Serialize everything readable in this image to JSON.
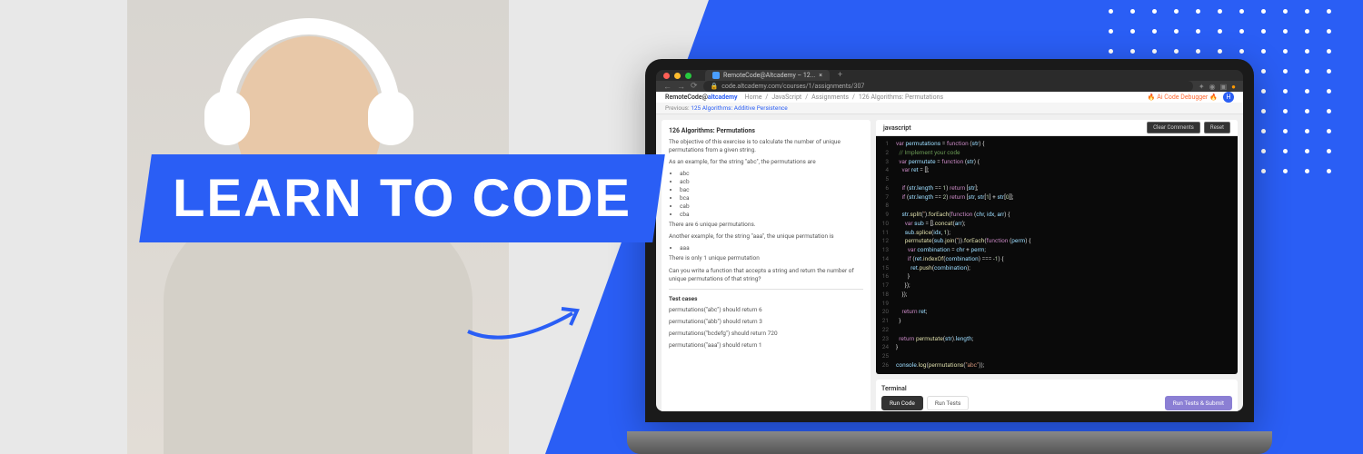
{
  "banner": "LEARN TO CODE",
  "browser": {
    "tab_title": "RemoteCode@Altcademy – 12...",
    "url": "code.altcademy.com/courses/1/assignments/307"
  },
  "header": {
    "logo_prefix": "RemoteCode@",
    "logo_brand": "altcademy",
    "breadcrumb": [
      "Home",
      "JavaScript",
      "Assignments",
      "126 Algorithms: Permutations"
    ],
    "ai_debugger": "Ai Code Debugger",
    "avatar_initial": "H"
  },
  "previous": {
    "label": "Previous:",
    "link": "125 Algorithms: Additive Persistence"
  },
  "problem": {
    "title": "126 Algorithms: Permutations",
    "objective": "The objective of this exercise is to calculate the number of unique permutations from a given string.",
    "example_intro": "As an example, for the string \"abc\", the permutations are",
    "perms": [
      "abc",
      "acb",
      "bac",
      "bca",
      "cab",
      "cba"
    ],
    "count_note": "There are 6 unique permutations.",
    "example2_intro": "Another example, for the string \"aaa\", the unique permutation is",
    "perms2": [
      "aaa"
    ],
    "count_note2": "There is only 1 unique permutation",
    "question": "Can you write a function that accepts a string and return the number of unique permutations of that string?",
    "test_title": "Test cases",
    "tests": [
      "permutations(\"abc\") should return 6",
      "permutations(\"abb\") should return 3",
      "permutations(\"bcdefg\") should return 720",
      "permutations(\"aaa\") should return 1"
    ]
  },
  "editor": {
    "language": "javascript",
    "clear_btn": "Clear Comments",
    "reset_btn": "Reset",
    "code": [
      {
        "n": "1",
        "html": "<span class='kw'>var</span> <span class='var'>permutations</span> <span class='op'>=</span> <span class='kw'>function</span> (<span class='var'>str</span>) {"
      },
      {
        "n": "2",
        "html": "  <span class='cm'>// Implement your code</span>"
      },
      {
        "n": "3",
        "html": "  <span class='kw'>var</span> <span class='var'>permutate</span> <span class='op'>=</span> <span class='kw'>function</span> (<span class='var'>str</span>) {"
      },
      {
        "n": "4",
        "html": "    <span class='kw'>var</span> <span class='var'>ret</span> <span class='op'>=</span> [];"
      },
      {
        "n": "5",
        "html": ""
      },
      {
        "n": "6",
        "html": "    <span class='kw'>if</span> (<span class='var'>str</span>.<span class='var'>length</span> <span class='op'>==</span> <span class='num'>1</span>) <span class='kw'>return</span> [<span class='var'>str</span>];"
      },
      {
        "n": "7",
        "html": "    <span class='kw'>if</span> (<span class='var'>str</span>.<span class='var'>length</span> <span class='op'>==</span> <span class='num'>2</span>) <span class='kw'>return</span> [<span class='var'>str</span>, <span class='var'>str</span>[<span class='num'>1</span>] + <span class='var'>str</span>[<span class='num'>0</span>]];"
      },
      {
        "n": "8",
        "html": ""
      },
      {
        "n": "9",
        "html": "    <span class='var'>str</span>.<span class='fn'>split</span>(<span class='str'>''</span>).<span class='fn'>forEach</span>(<span class='kw'>function</span> (<span class='var'>chr</span>, <span class='var'>idx</span>, <span class='var'>arr</span>) {"
      },
      {
        "n": "10",
        "html": "      <span class='kw'>var</span> <span class='var'>sub</span> <span class='op'>=</span> [].<span class='fn'>concat</span>(<span class='var'>arr</span>);"
      },
      {
        "n": "11",
        "html": "      <span class='var'>sub</span>.<span class='fn'>splice</span>(<span class='var'>idx</span>, <span class='num'>1</span>);"
      },
      {
        "n": "12",
        "html": "      <span class='fn'>permutate</span>(<span class='var'>sub</span>.<span class='fn'>join</span>(<span class='str'>''</span>)).<span class='fn'>forEach</span>(<span class='kw'>function</span> (<span class='var'>perm</span>) {"
      },
      {
        "n": "13",
        "html": "        <span class='kw'>var</span> <span class='var'>combination</span> <span class='op'>=</span> <span class='var'>chr</span> + <span class='var'>perm</span>;"
      },
      {
        "n": "14",
        "html": "        <span class='kw'>if</span> (<span class='var'>ret</span>.<span class='fn'>indexOf</span>(<span class='var'>combination</span>) <span class='op'>===</span> <span class='op'>-</span><span class='num'>1</span>) {"
      },
      {
        "n": "15",
        "html": "          <span class='var'>ret</span>.<span class='fn'>push</span>(<span class='var'>combination</span>);"
      },
      {
        "n": "16",
        "html": "        }"
      },
      {
        "n": "17",
        "html": "      });"
      },
      {
        "n": "18",
        "html": "    });"
      },
      {
        "n": "19",
        "html": ""
      },
      {
        "n": "20",
        "html": "    <span class='kw'>return</span> <span class='var'>ret</span>;"
      },
      {
        "n": "21",
        "html": "  }"
      },
      {
        "n": "22",
        "html": ""
      },
      {
        "n": "23",
        "html": "  <span class='kw'>return</span> <span class='fn'>permutate</span>(<span class='var'>str</span>).<span class='var'>length</span>;"
      },
      {
        "n": "24",
        "html": "}"
      },
      {
        "n": "25",
        "html": ""
      },
      {
        "n": "26",
        "html": "<span class='var'>console</span>.<span class='fn'>log</span>(<span class='fn'>permutations</span>(<span class='str'>\"abc\"</span>));"
      }
    ]
  },
  "terminal": {
    "title": "Terminal",
    "run_code": "Run Code",
    "run_tests": "Run Tests",
    "submit": "Run Tests & Submit"
  }
}
